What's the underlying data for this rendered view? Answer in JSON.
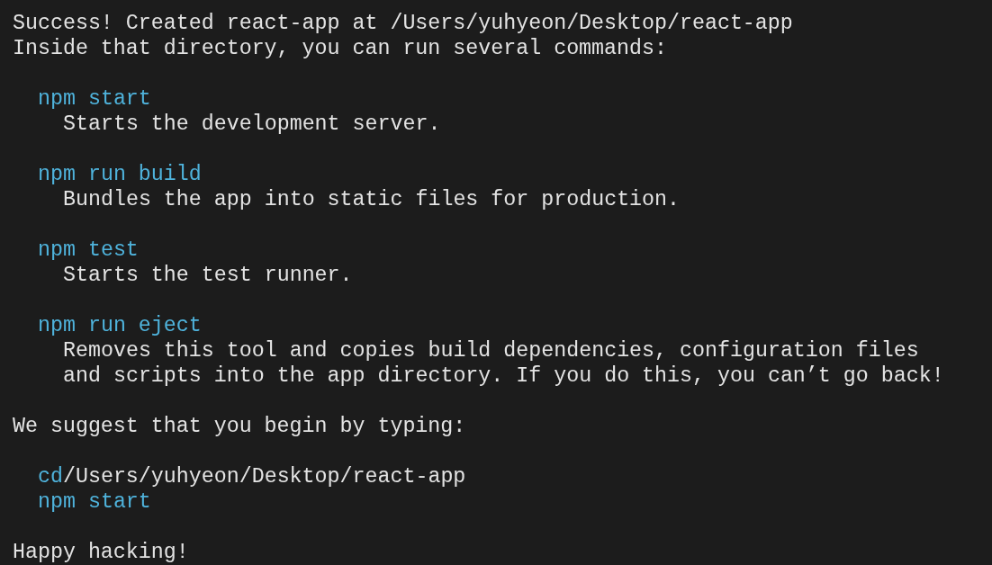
{
  "terminal": {
    "lines": [
      {
        "kind": "message",
        "text": "Success! Created react-app at /Users/yuhyeon/Desktop/react-app"
      },
      {
        "kind": "message",
        "text": "Inside that directory, you can run several commands:"
      },
      {
        "kind": "blank"
      },
      {
        "kind": "command",
        "command": "npm start"
      },
      {
        "kind": "description",
        "text": "Starts the development server."
      },
      {
        "kind": "blank"
      },
      {
        "kind": "command",
        "command": "npm run build"
      },
      {
        "kind": "description",
        "text": "Bundles the app into static files for production."
      },
      {
        "kind": "blank"
      },
      {
        "kind": "command",
        "command": "npm test"
      },
      {
        "kind": "description",
        "text": "Starts the test runner."
      },
      {
        "kind": "blank"
      },
      {
        "kind": "command",
        "command": "npm run eject"
      },
      {
        "kind": "description",
        "text": "Removes this tool and copies build dependencies, configuration files"
      },
      {
        "kind": "description",
        "text": "and scripts into the app directory. If you do this, you can’t go back!"
      },
      {
        "kind": "blank"
      },
      {
        "kind": "message",
        "text": "We suggest that you begin by typing:"
      },
      {
        "kind": "blank"
      },
      {
        "kind": "command",
        "command": "cd",
        "argument": "/Users/yuhyeon/Desktop/react-app"
      },
      {
        "kind": "command",
        "command": "npm start"
      },
      {
        "kind": "blank"
      },
      {
        "kind": "message",
        "text": "Happy hacking!"
      }
    ]
  }
}
